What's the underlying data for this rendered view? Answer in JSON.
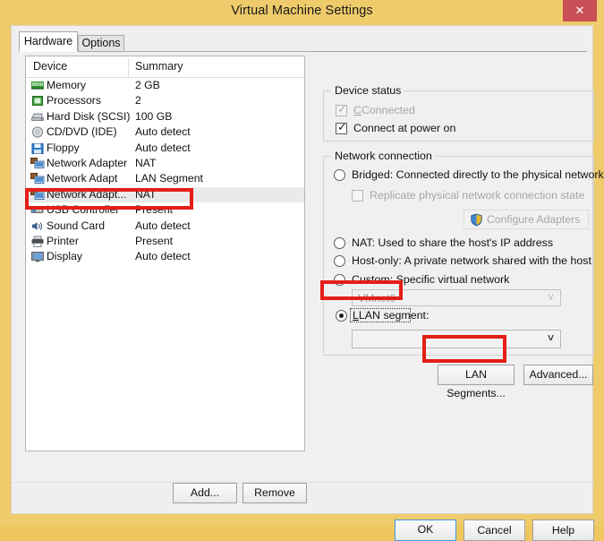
{
  "window": {
    "title": "Virtual Machine Settings",
    "close_label": "✕",
    "frame_color": "#efcb6b",
    "close_color": "#c84f56"
  },
  "tabs": [
    {
      "label": "Hardware",
      "active": true
    },
    {
      "label": "Options",
      "active": false
    }
  ],
  "device_list": {
    "columns": [
      "Device",
      "Summary"
    ],
    "rows": [
      {
        "icon": "memory-icon",
        "name": "Memory",
        "summary": "2 GB",
        "selected": false
      },
      {
        "icon": "processor-icon",
        "name": "Processors",
        "summary": "2",
        "selected": false
      },
      {
        "icon": "hard-disk-icon",
        "name": "Hard Disk (SCSI)",
        "summary": "100 GB",
        "selected": false
      },
      {
        "icon": "cd-dvd-icon",
        "name": "CD/DVD (IDE)",
        "summary": "Auto detect",
        "selected": false
      },
      {
        "icon": "floppy-icon",
        "name": "Floppy",
        "summary": "Auto detect",
        "selected": false
      },
      {
        "icon": "network-adapter-icon",
        "name": "Network Adapter",
        "summary": "NAT",
        "selected": false
      },
      {
        "icon": "network-adapter-icon",
        "name": "Network Adapt",
        "summary": "LAN Segment",
        "selected": false
      },
      {
        "icon": "network-adapter-icon",
        "name": "Network Adapt...",
        "summary": "NAT",
        "selected": true
      },
      {
        "icon": "usb-controller-icon",
        "name": "USB Controller",
        "summary": "Present",
        "selected": false
      },
      {
        "icon": "sound-card-icon",
        "name": "Sound Card",
        "summary": "Auto detect",
        "selected": false
      },
      {
        "icon": "printer-icon",
        "name": "Printer",
        "summary": "Present",
        "selected": false
      },
      {
        "icon": "display-icon",
        "name": "Display",
        "summary": "Auto detect",
        "selected": false
      }
    ]
  },
  "list_buttons": {
    "add": "Add...",
    "remove": "Remove"
  },
  "device_status": {
    "legend": "Device status",
    "connected": {
      "label": "Connected",
      "checked": true,
      "disabled": true,
      "mnemonic": "C"
    },
    "connect_at_power_on": {
      "label": "Connect at power on",
      "checked": true,
      "disabled": false,
      "mnemonic": "o"
    }
  },
  "network_connection": {
    "legend": "Network connection",
    "options": [
      {
        "label": "Bridged: Connected directly to the physical network",
        "selected": false
      },
      {
        "label": "NAT: Used to share the host's IP address",
        "selected": false
      },
      {
        "label": "Host-only: A private network shared with the host",
        "selected": false
      },
      {
        "label": "Custom: Specific virtual network",
        "selected": false
      },
      {
        "label": "LAN segment:",
        "selected": true
      }
    ],
    "replicate_checkbox": {
      "label": "Replicate physical network connection state",
      "checked": false,
      "disabled": true
    },
    "configure_adapters_button": "Configure Adapters",
    "custom_network_combo": {
      "value": "VMnet0",
      "disabled": true
    },
    "lan_segment_combo": {
      "value": "",
      "disabled": false
    },
    "lan_segments_button": "LAN Segments...",
    "advanced_button": "Advanced..."
  },
  "footer": {
    "ok": "OK",
    "cancel": "Cancel",
    "help": "Help"
  },
  "annotations": {
    "color": "#e41e17",
    "boxes": [
      "selected-network-adapter-row",
      "lan-segment-radio",
      "lan-segments-button"
    ]
  }
}
